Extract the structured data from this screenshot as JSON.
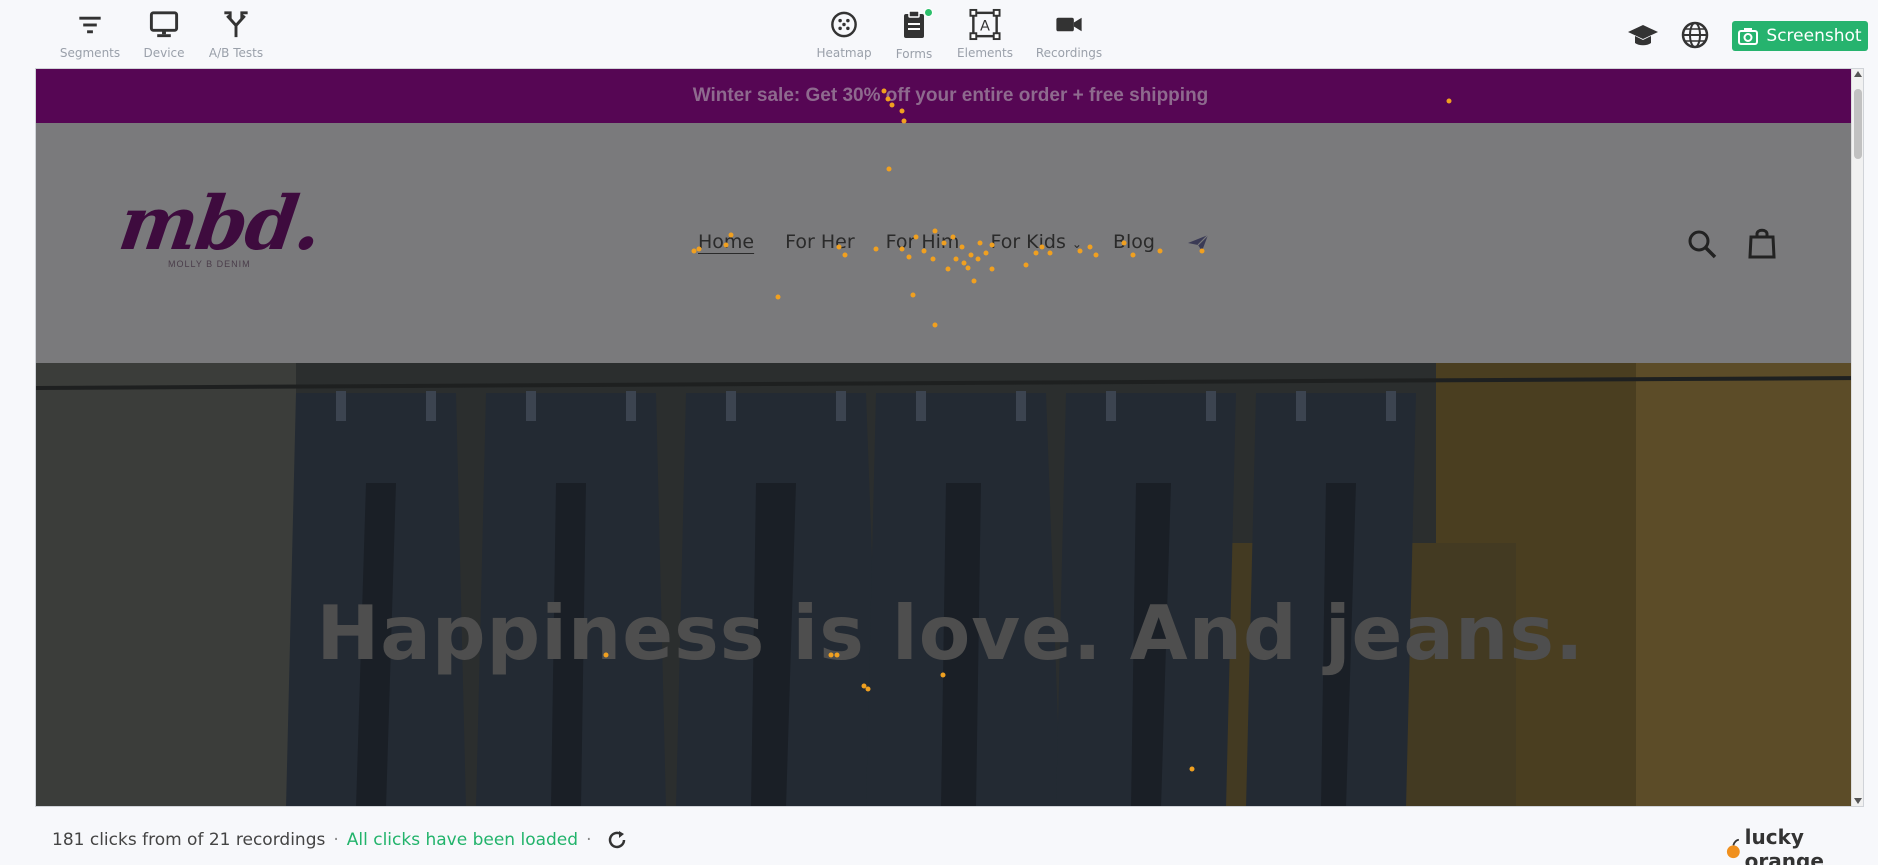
{
  "toolbar": {
    "left_tools": [
      {
        "label": "Segments",
        "icon": "filter-icon"
      },
      {
        "label": "Device",
        "icon": "monitor-icon"
      },
      {
        "label": "A/B Tests",
        "icon": "split-icon"
      }
    ],
    "center_tools": [
      {
        "label": "Heatmap",
        "icon": "heatmap-icon"
      },
      {
        "label": "Forms",
        "icon": "clipboard-icon"
      },
      {
        "label": "Elements",
        "icon": "elements-icon"
      },
      {
        "label": "Recordings",
        "icon": "video-camera-icon"
      }
    ],
    "right_icons": [
      "graduation-cap-icon",
      "globe-icon"
    ],
    "screenshot_label": "Screenshot",
    "accent_color": "#26b36e"
  },
  "site": {
    "announcement": "Winter sale: Get 30% off your entire order + free shipping",
    "logo": {
      "wordmark": "mbd.",
      "tagline": "MOLLY B DENIM"
    },
    "nav": [
      {
        "label": "Home",
        "active": true
      },
      {
        "label": "For Her"
      },
      {
        "label": "For Him"
      },
      {
        "label": "For Kids",
        "has_dropdown": true
      },
      {
        "label": "Blog"
      }
    ],
    "hero_title": "Happiness is love. And jeans."
  },
  "status": {
    "clicks_text": "181 clicks from of 21 recordings",
    "loaded_text": "All clicks have been loaded",
    "separator": "·"
  },
  "brand": "lucky orange"
}
